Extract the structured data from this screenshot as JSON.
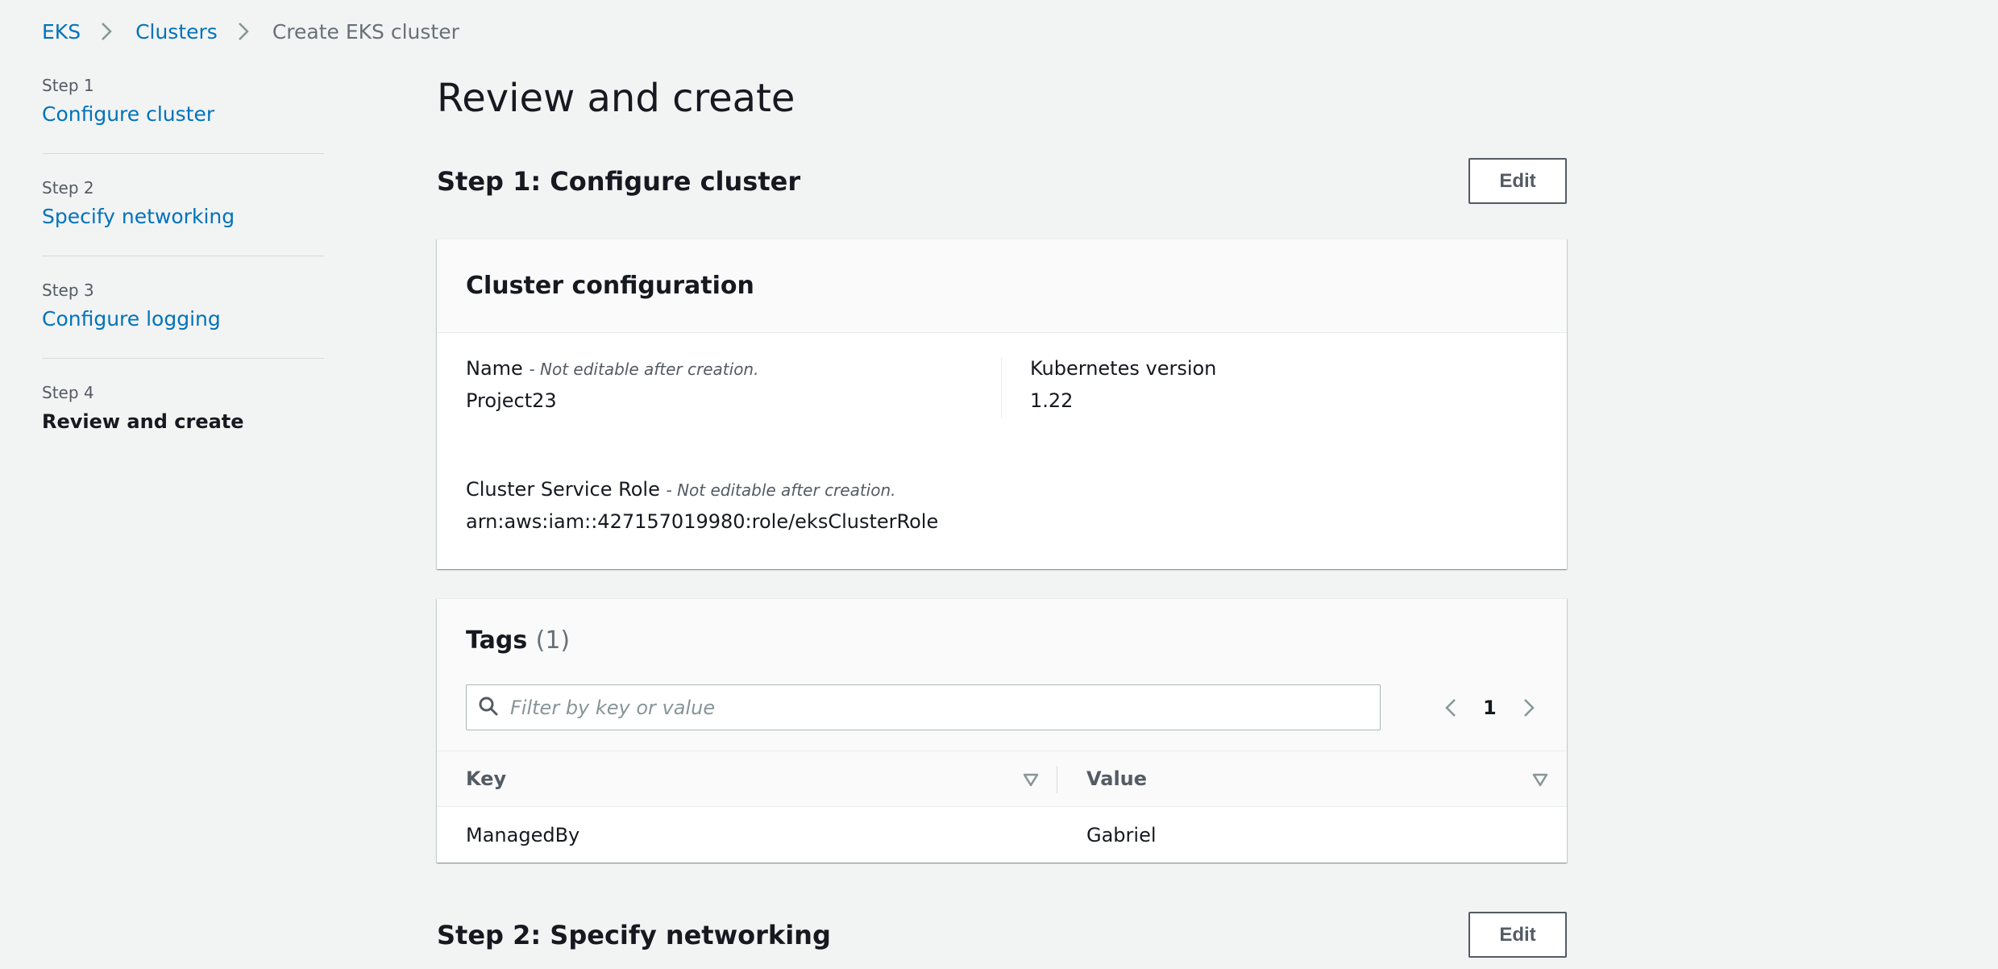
{
  "breadcrumb": {
    "items": [
      {
        "label": "EKS"
      },
      {
        "label": "Clusters"
      }
    ],
    "current": "Create EKS cluster"
  },
  "steps": [
    {
      "number": "Step 1",
      "label": "Configure cluster"
    },
    {
      "number": "Step 2",
      "label": "Specify networking"
    },
    {
      "number": "Step 3",
      "label": "Configure logging"
    },
    {
      "number": "Step 4",
      "label": "Review and create"
    }
  ],
  "page_title": "Review and create",
  "step1": {
    "title": "Step 1: Configure cluster",
    "edit_label": "Edit",
    "cluster_config": {
      "title": "Cluster configuration",
      "name_label": "Name",
      "name_note": "- Not editable after creation.",
      "name_value": "Project23",
      "k8s_label": "Kubernetes version",
      "k8s_value": "1.22",
      "role_label": "Cluster Service Role",
      "role_note": "- Not editable after creation.",
      "role_value": "arn:aws:iam::427157019980:role/eksClusterRole"
    },
    "tags": {
      "title": "Tags",
      "count": "(1)",
      "filter_placeholder": "Filter by key or value",
      "page": "1",
      "columns": {
        "key": "Key",
        "value": "Value"
      },
      "rows": [
        {
          "key": "ManagedBy",
          "value": "Gabriel"
        }
      ]
    }
  },
  "step2": {
    "title": "Step 2: Specify networking",
    "edit_label": "Edit"
  },
  "colors": {
    "link": "#0073bb",
    "background": "#f2f3f3",
    "text": "#16191f",
    "muted": "#687078"
  }
}
